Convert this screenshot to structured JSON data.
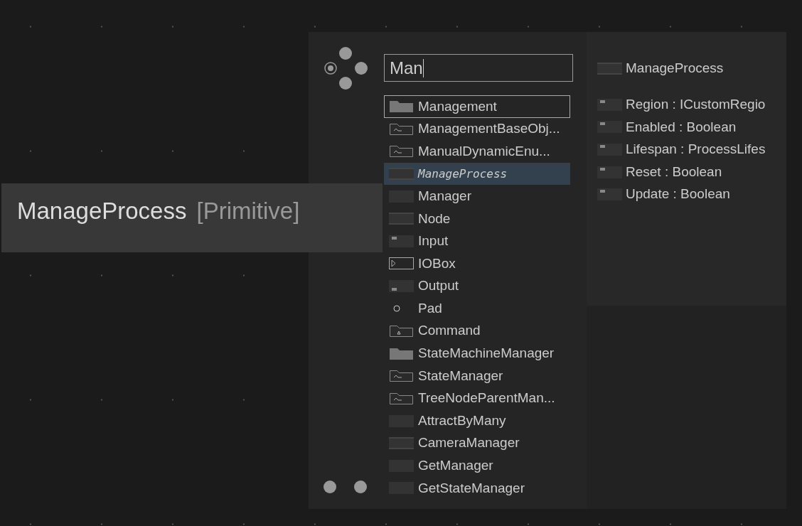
{
  "tooltip": {
    "name": "ManageProcess",
    "category": "[Primitive]"
  },
  "search": {
    "value": "Man"
  },
  "results": [
    {
      "kind": "folder",
      "label": "Management",
      "selected": false,
      "focused": true
    },
    {
      "kind": "folder-wave",
      "label": "ManagementBaseObj...",
      "selected": false,
      "focused": false
    },
    {
      "kind": "folder-wave",
      "label": "ManualDynamicEnu...",
      "selected": false,
      "focused": false
    },
    {
      "kind": "node-lines",
      "label": "ManageProcess",
      "selected": true,
      "focused": false
    },
    {
      "kind": "node",
      "label": "Manager",
      "selected": false,
      "focused": false
    },
    {
      "kind": "node-lines",
      "label": "Node",
      "selected": false,
      "focused": false
    },
    {
      "kind": "input",
      "label": "Input",
      "selected": false,
      "focused": false
    },
    {
      "kind": "iobox",
      "label": "IOBox",
      "selected": false,
      "focused": false
    },
    {
      "kind": "output",
      "label": "Output",
      "selected": false,
      "focused": false
    },
    {
      "kind": "pad",
      "label": "Pad",
      "selected": false,
      "focused": false
    },
    {
      "kind": "folder-triangle",
      "label": "Command",
      "selected": false,
      "focused": false
    },
    {
      "kind": "folder",
      "label": "StateMachineManager",
      "selected": false,
      "focused": false
    },
    {
      "kind": "folder-wave",
      "label": "StateManager",
      "selected": false,
      "focused": false
    },
    {
      "kind": "folder-wave",
      "label": "TreeNodeParentMan...",
      "selected": false,
      "focused": false
    },
    {
      "kind": "node",
      "label": "AttractByMany",
      "selected": false,
      "focused": false
    },
    {
      "kind": "node-lines",
      "label": "CameraManager",
      "selected": false,
      "focused": false
    },
    {
      "kind": "node",
      "label": "GetManager",
      "selected": false,
      "focused": false
    },
    {
      "kind": "node",
      "label": "GetStateManager",
      "selected": false,
      "focused": false
    }
  ],
  "details": {
    "title": "ManageProcess",
    "pins": [
      {
        "label": "Region : ICustomRegio"
      },
      {
        "label": "Enabled : Boolean"
      },
      {
        "label": "Lifespan : ProcessLifes"
      },
      {
        "label": "Reset : Boolean"
      },
      {
        "label": "Update : Boolean"
      }
    ]
  }
}
